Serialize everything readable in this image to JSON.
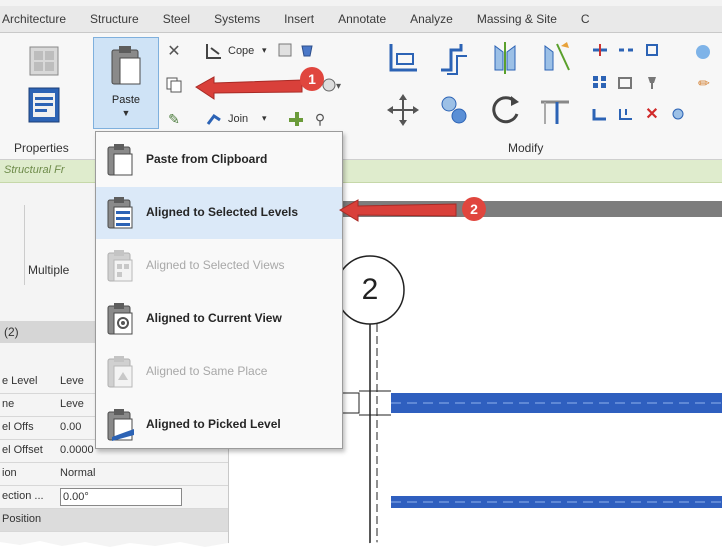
{
  "ribbon": {
    "tabs": [
      "Architecture",
      "Structure",
      "Steel",
      "Systems",
      "Insert",
      "Annotate",
      "Analyze",
      "Massing & Site",
      "C"
    ],
    "properties_label": "Properties",
    "paste_label": "Paste",
    "cope_label": "Cope",
    "join_label": "Join",
    "modify_label": "Modify"
  },
  "options_bar": {
    "text": "Structural Fr"
  },
  "properties_panel": {
    "type_label": "Multiple",
    "count_label": "(2)",
    "rows": [
      {
        "key": "e Level",
        "value": "Leve"
      },
      {
        "key": "ne",
        "value": "Leve"
      },
      {
        "key": "el Offs",
        "value": "0.00"
      },
      {
        "key": "el Offset",
        "value": "0.0000"
      },
      {
        "key": "ion",
        "value": "Normal"
      },
      {
        "key": "ection ...",
        "value": "0.00°"
      },
      {
        "key": "Position",
        "value": ""
      }
    ]
  },
  "canvas": {
    "level_marker": "2"
  },
  "paste_menu": {
    "items": [
      {
        "label": "Paste from Clipboard",
        "state": "enabled"
      },
      {
        "label": "Aligned to Selected Levels",
        "state": "enabled"
      },
      {
        "label": "Aligned to Selected Views",
        "state": "disabled"
      },
      {
        "label": "Aligned to Current View",
        "state": "enabled"
      },
      {
        "label": "Aligned to Same Place",
        "state": "disabled"
      },
      {
        "label": "Aligned to Picked Level",
        "state": "enabled"
      }
    ]
  },
  "callouts": {
    "one": "1",
    "two": "2"
  },
  "colors": {
    "callout_red": "#e0463e",
    "paste_highlight": "#cfe3f6",
    "beam_blue": "#2f5fbf",
    "options_green": "#dfeccd"
  }
}
